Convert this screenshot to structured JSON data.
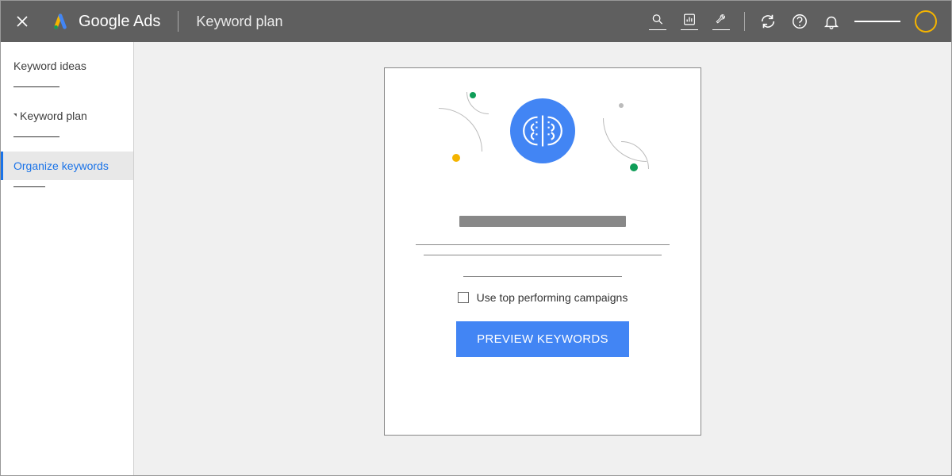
{
  "header": {
    "brand": "Google Ads",
    "page_title": "Keyword plan"
  },
  "sidebar": {
    "items": [
      {
        "label": "Keyword ideas"
      },
      {
        "label": "Keyword plan"
      },
      {
        "label": "Organize keywords"
      }
    ]
  },
  "card": {
    "checkbox_label": "Use top performing campaigns",
    "cta_label": "PREVIEW KEYWORDS"
  },
  "icons": {
    "close": "close-icon",
    "search": "search-icon",
    "reports": "bar-chart-icon",
    "tools": "wrench-icon",
    "refresh": "refresh-icon",
    "help": "help-icon",
    "notifications": "bell-icon",
    "brain": "brain-icon"
  },
  "colors": {
    "primary": "#4285f4",
    "green": "#0f9d58",
    "yellow": "#f4b400",
    "header": "#5f5f5f"
  }
}
